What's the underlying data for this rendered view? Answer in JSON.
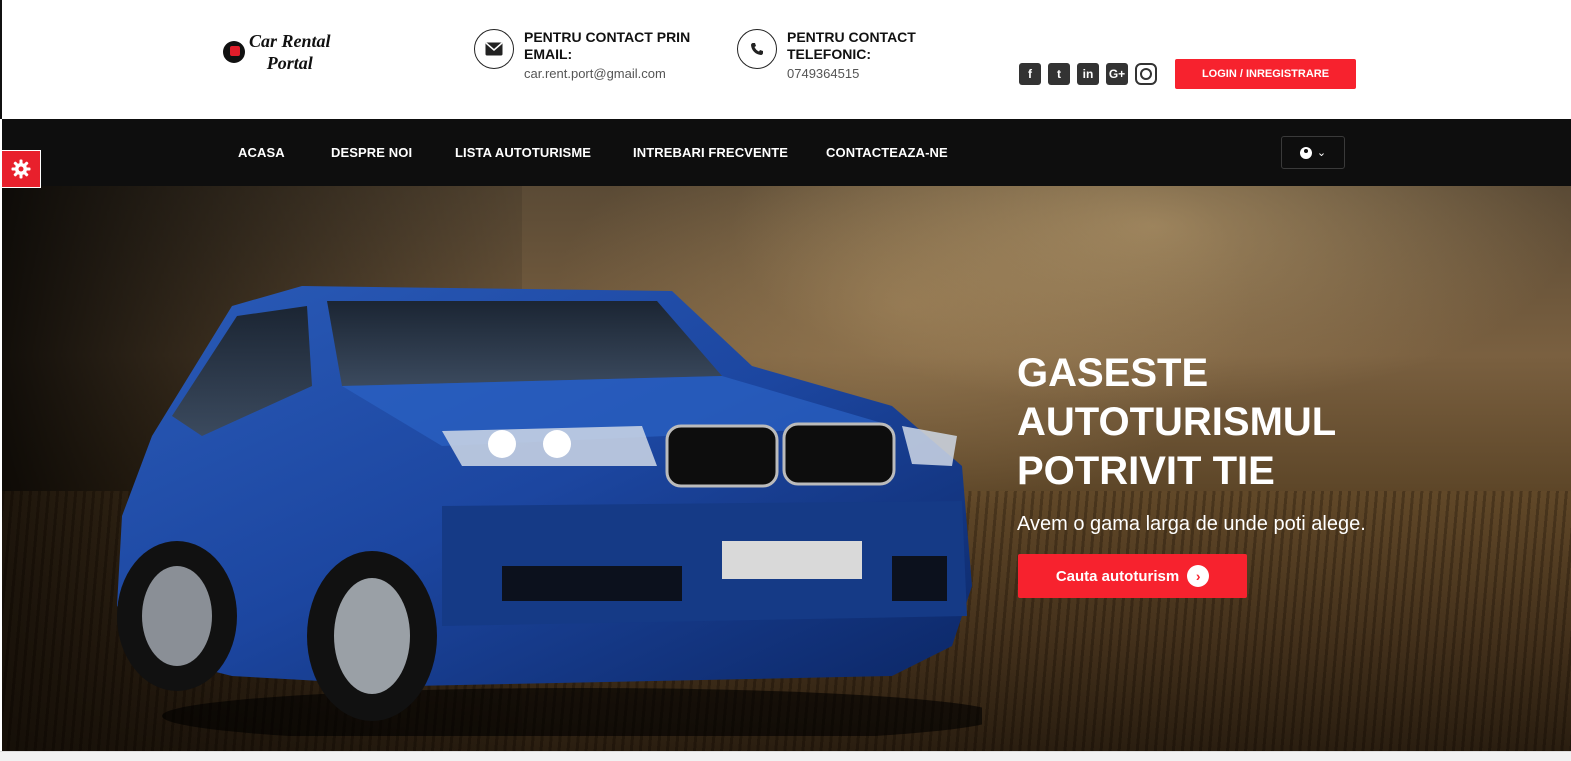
{
  "header": {
    "logo_line1": "Car Rental",
    "logo_line2": "Portal",
    "contact_email": {
      "title": "PENTRU CONTACT PRIN EMAIL:",
      "value": "car.rent.port@gmail.com",
      "icon": "envelope-icon"
    },
    "contact_phone": {
      "title": "PENTRU CONTACT TELEFONIC:",
      "value": "0749364515",
      "icon": "phone-icon"
    },
    "socials": [
      {
        "icon": "facebook-icon",
        "glyph": "f"
      },
      {
        "icon": "twitter-icon",
        "glyph": "t"
      },
      {
        "icon": "linkedin-icon",
        "glyph": "in"
      },
      {
        "icon": "google-plus-icon",
        "glyph": "G+"
      },
      {
        "icon": "instagram-icon",
        "glyph": ""
      }
    ],
    "login_label": "LOGIN / INREGISTRARE"
  },
  "nav": {
    "items": [
      "ACASA",
      "DESPRE NOI",
      "LISTA AUTOTURISME",
      "INTREBARI FRECVENTE",
      "CONTACTEAZA-NE"
    ],
    "user_dropdown_caret": "⌄"
  },
  "hero": {
    "title": "GASESTE AUTOTURISMUL POTRIVIT TIE",
    "subtitle": "Avem o gama larga de unde poti alege.",
    "cta_label": "Cauta autoturism",
    "cta_arrow": "›"
  },
  "colors": {
    "accent": "#f7222e",
    "nav_bg": "#0e0e0e"
  }
}
